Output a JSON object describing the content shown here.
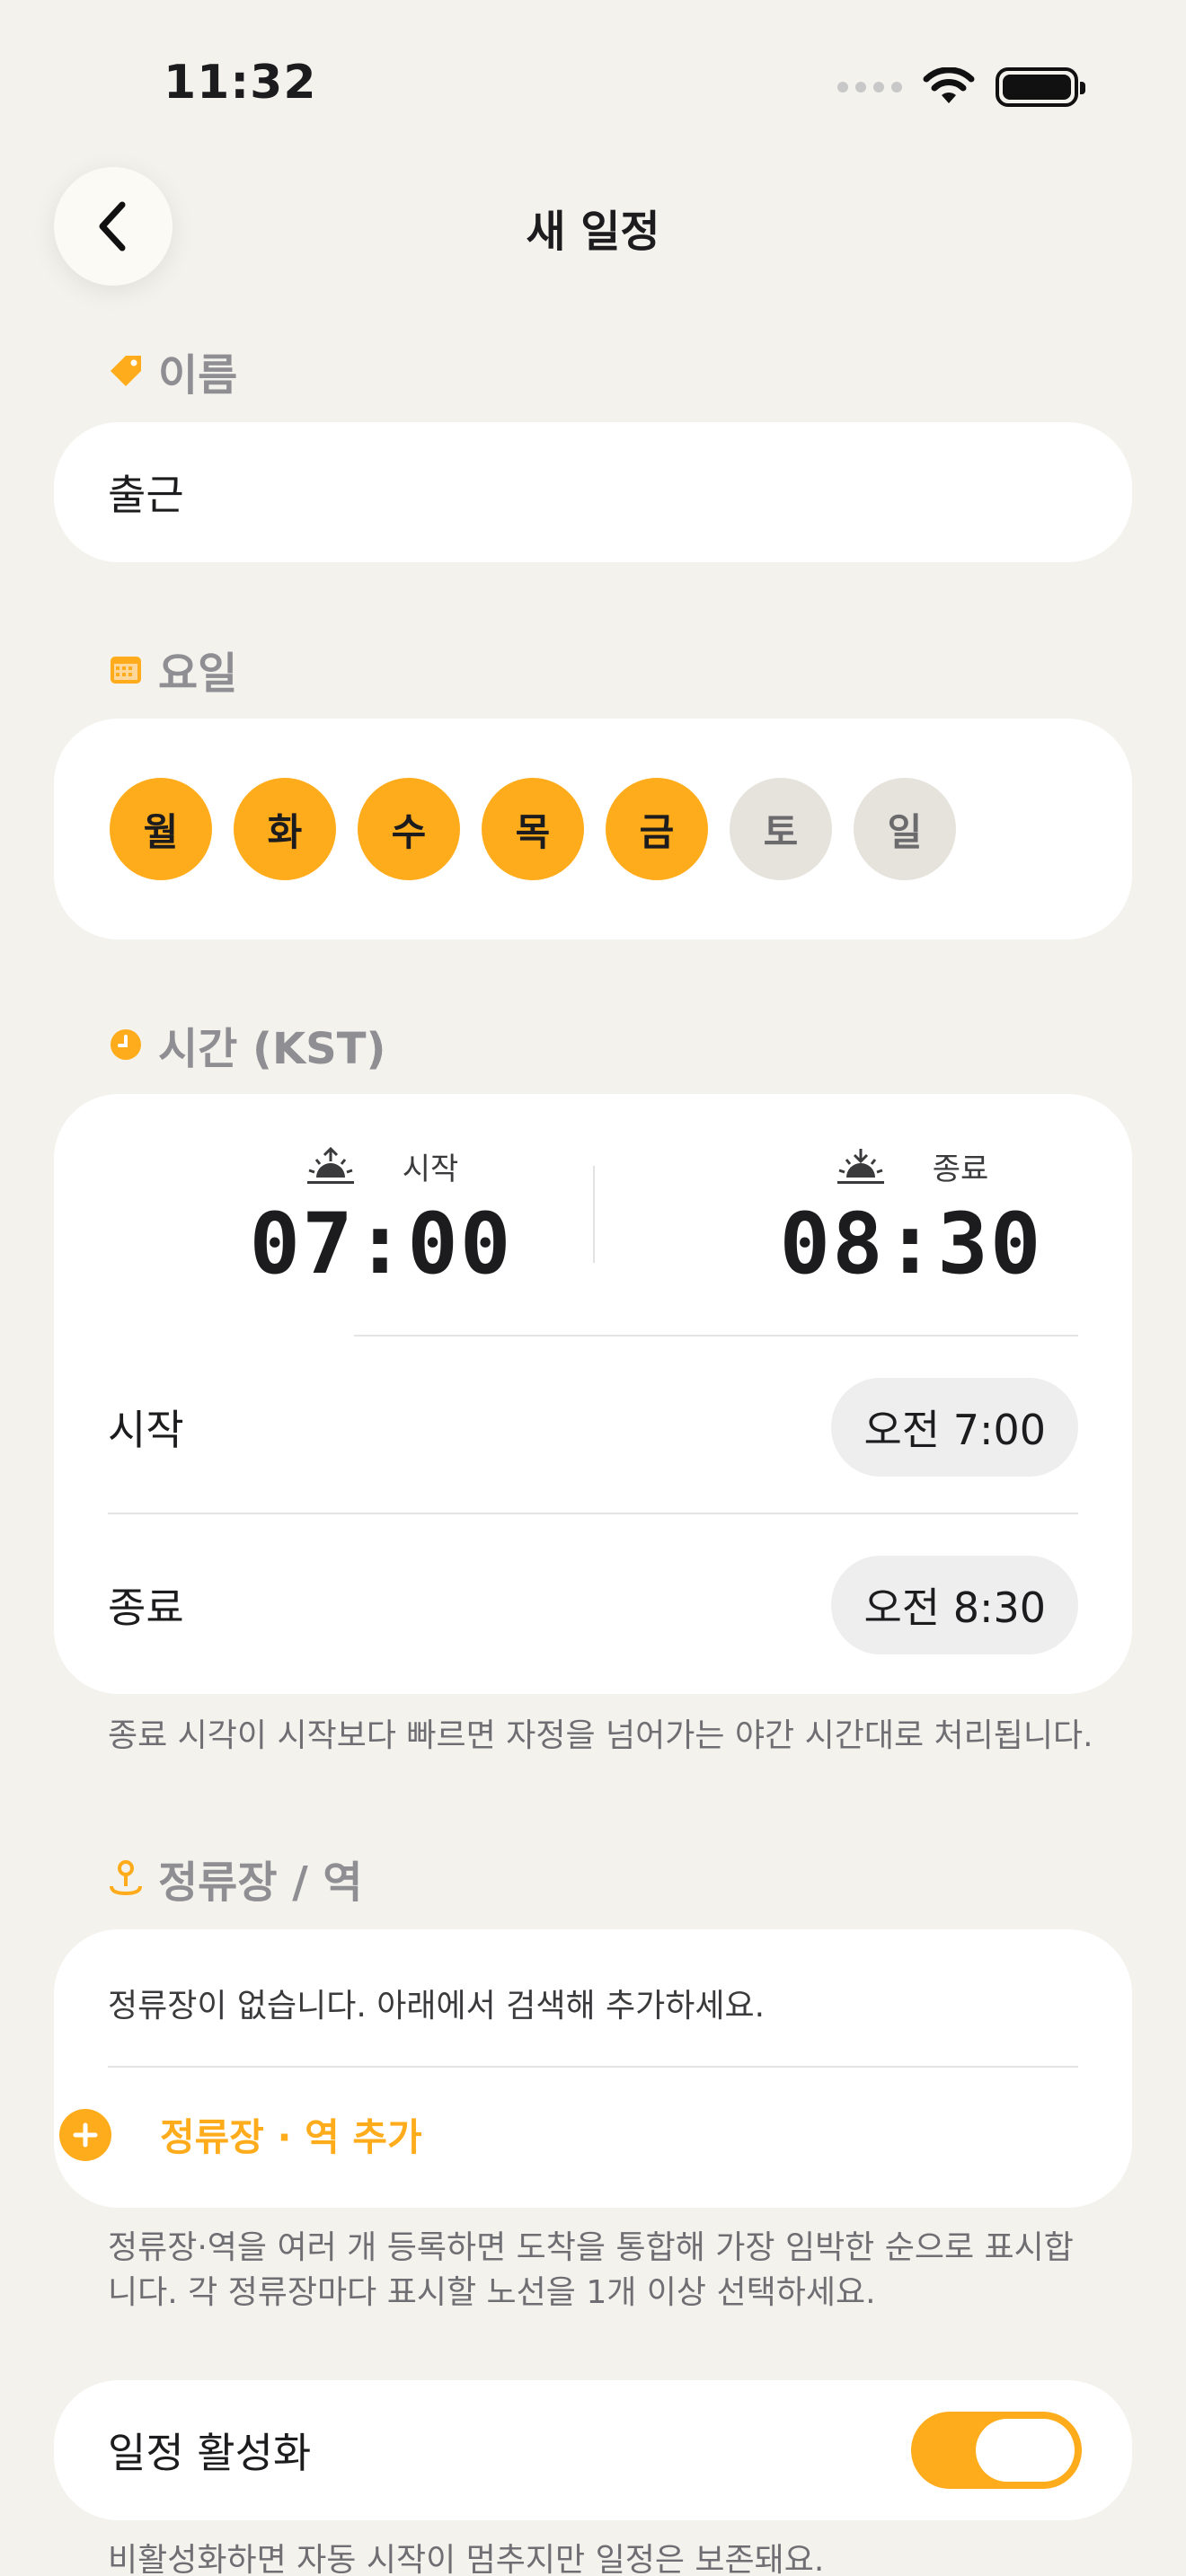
{
  "status_bar": {
    "time": "11:32"
  },
  "nav": {
    "title": "새 일정"
  },
  "name_section": {
    "label": "이름",
    "value": "출근"
  },
  "days_section": {
    "label": "요일",
    "days": [
      {
        "label": "월",
        "selected": true
      },
      {
        "label": "화",
        "selected": true
      },
      {
        "label": "수",
        "selected": true
      },
      {
        "label": "목",
        "selected": true
      },
      {
        "label": "금",
        "selected": true
      },
      {
        "label": "토",
        "selected": false
      },
      {
        "label": "일",
        "selected": false
      }
    ]
  },
  "time_section": {
    "label": "시간 (KST)",
    "start_label": "시작",
    "start_big": "07:00",
    "end_label": "종료",
    "end_big": "08:30",
    "start_row_label": "시작",
    "start_row_value": "오전 7:00",
    "end_row_label": "종료",
    "end_row_value": "오전 8:30",
    "note": "종료 시각이 시작보다 빠르면 자정을 넘어가는 야간 시간대로 처리됩니다."
  },
  "stops_section": {
    "label": "정류장 / 역",
    "empty_text": "정류장이 없습니다. 아래에서 검색해 추가하세요.",
    "add_label": "정류장 · 역 추가",
    "note": "정류장·역을 여러 개 등록하면 도착을 통합해 가장 임박한 순으로 표시합니다. 각 정류장마다 표시할 노선을 1개 이상 선택하세요."
  },
  "active_section": {
    "label": "일정 활성화",
    "enabled": true,
    "note": "비활성화하면 자동 시작이 멈추지만 일정은 보존돼요."
  },
  "colors": {
    "accent": "#ffac1c",
    "background": "#f3f2ed",
    "card": "#ffffff"
  }
}
